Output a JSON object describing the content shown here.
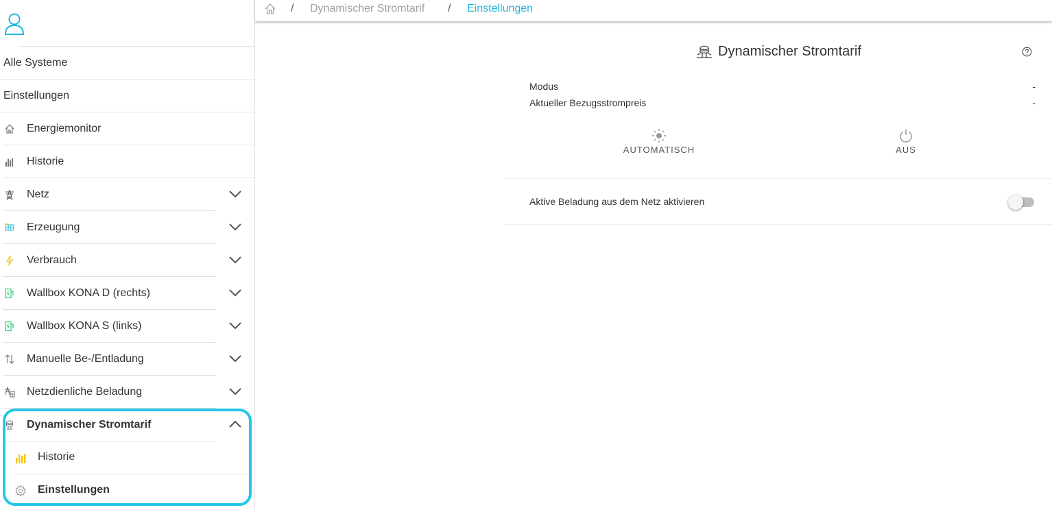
{
  "breadcrumb": {
    "separator": "/",
    "parent": "Dynamischer Stromtarif",
    "current": "Einstellungen"
  },
  "sidebar": {
    "top_links": [
      "Alle Systeme",
      "Einstellungen"
    ],
    "items": [
      {
        "label": "Energiemonitor",
        "icon": "home-icon",
        "expandable": false
      },
      {
        "label": "Historie",
        "icon": "bar-chart-icon",
        "expandable": false
      },
      {
        "label": "Netz",
        "icon": "power-pylon-icon",
        "expandable": true
      },
      {
        "label": "Erzeugung",
        "icon": "solar-panel-icon",
        "expandable": true
      },
      {
        "label": "Verbrauch",
        "icon": "lightning-icon",
        "expandable": true
      },
      {
        "label": "Wallbox KONA D (rechts)",
        "icon": "wallbox-icon",
        "expandable": true
      },
      {
        "label": "Wallbox KONA S (links)",
        "icon": "wallbox-icon",
        "expandable": true
      },
      {
        "label": "Manuelle Be-/Entladung",
        "icon": "up-down-arrows-icon",
        "expandable": true
      },
      {
        "label": "Netzdienliche Beladung",
        "icon": "grid-charging-icon",
        "expandable": true
      },
      {
        "label": "Dynamischer Stromtarif",
        "icon": "coin-stack-icon",
        "expandable": true,
        "expanded": true,
        "active": true
      }
    ],
    "sub_items": [
      {
        "label": "Historie",
        "icon": "bar-chart-icon"
      },
      {
        "label": "Einstellungen",
        "icon": "gear-icon",
        "active": true
      }
    ]
  },
  "main": {
    "title": "Dynamischer Stromtarif",
    "rows": [
      {
        "label": "Modus",
        "value": "-"
      },
      {
        "label": "Aktueller Bezugsstrompreis",
        "value": "-"
      }
    ],
    "modes": [
      {
        "label": "AUTOMATISCH",
        "icon": "sun-icon"
      },
      {
        "label": "AUS",
        "icon": "power-icon"
      }
    ],
    "toggle_label": "Aktive Beladung aus dem Netz aktivieren",
    "toggle_on": false
  },
  "colors": {
    "accent": "#1fb8e0",
    "highlight": "#26c6e8",
    "yellow": "#f5c518",
    "green": "#2ecc71"
  }
}
